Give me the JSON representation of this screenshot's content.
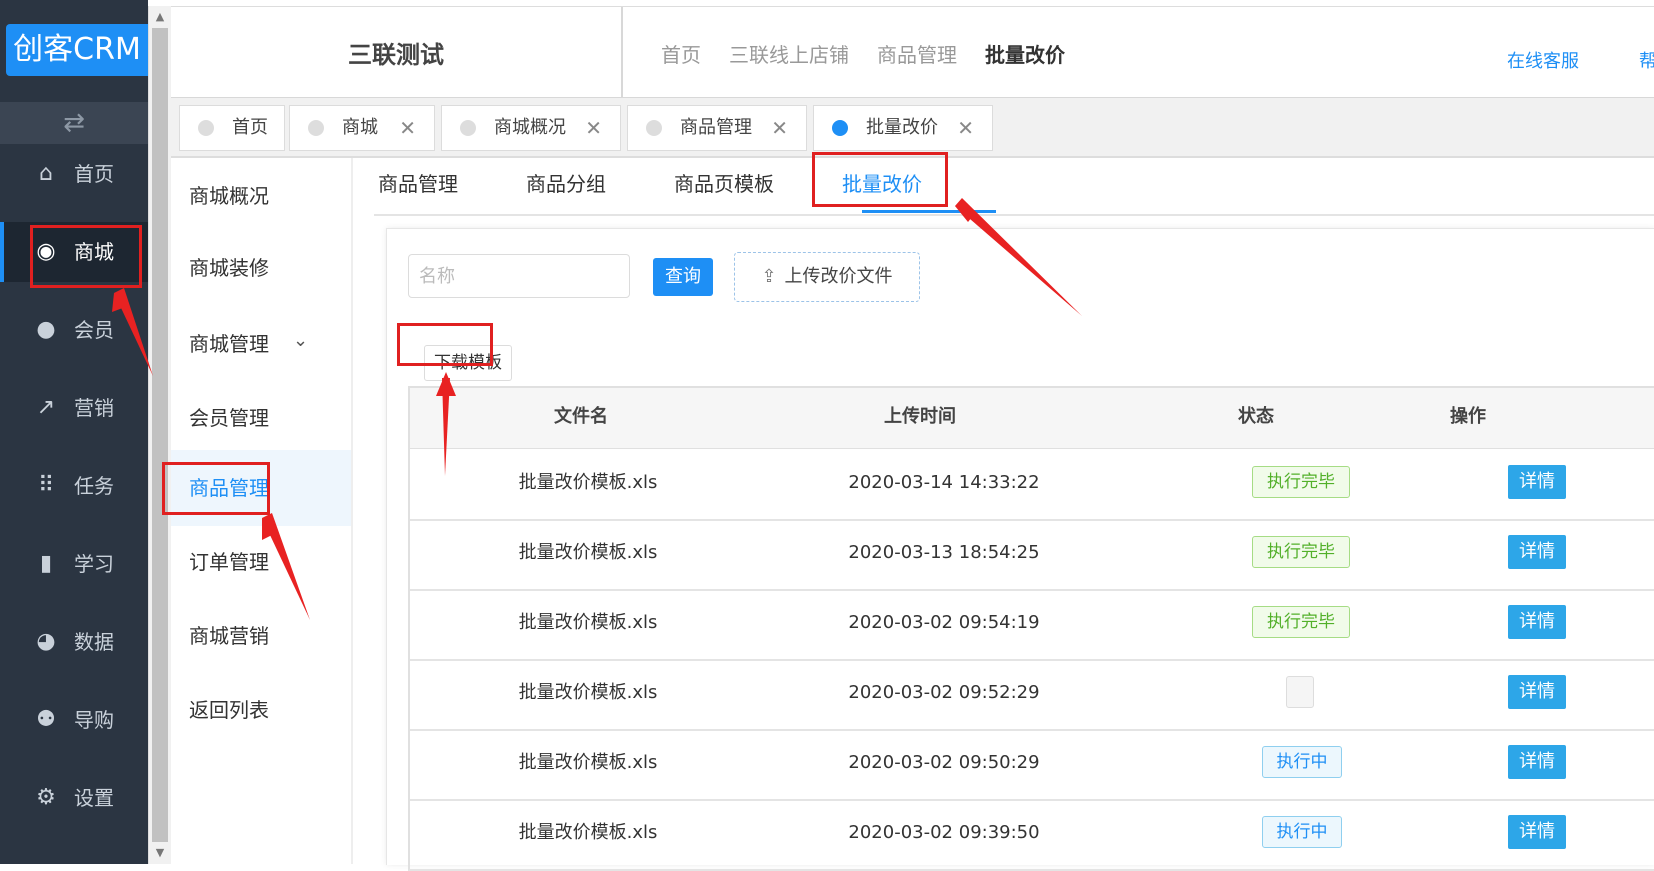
{
  "app": {
    "logo": "创客CRM",
    "toggle_icon": "swap-icon"
  },
  "leftnav": [
    {
      "label": "首页",
      "icon": "home-icon",
      "glyph": "⌂"
    },
    {
      "label": "商城",
      "icon": "store-icon",
      "glyph": "◉",
      "active": true
    },
    {
      "label": "会员",
      "icon": "user-icon",
      "glyph": "●"
    },
    {
      "label": "营销",
      "icon": "trend-icon",
      "glyph": "↗"
    },
    {
      "label": "任务",
      "icon": "grid-icon",
      "glyph": "⠿"
    },
    {
      "label": "学习",
      "icon": "book-icon",
      "glyph": "▮"
    },
    {
      "label": "数据",
      "icon": "pie-icon",
      "glyph": "◕"
    },
    {
      "label": "导购",
      "icon": "group-icon",
      "glyph": "⚉"
    },
    {
      "label": "设置",
      "icon": "gear-icon",
      "glyph": "⚙"
    }
  ],
  "header": {
    "shop_title": "三联测试",
    "breadcrumb": [
      "首页",
      "三联线上店铺",
      "商品管理",
      "批量改价"
    ],
    "service": "在线客服",
    "help": "帮"
  },
  "page_tabs": [
    {
      "label": "首页",
      "closable": false
    },
    {
      "label": "商城",
      "closable": true
    },
    {
      "label": "商城概况",
      "closable": true
    },
    {
      "label": "商品管理",
      "closable": true
    },
    {
      "label": "批量改价",
      "closable": true,
      "active": true
    }
  ],
  "subnav": [
    {
      "label": "商城概况"
    },
    {
      "label": "商城装修"
    },
    {
      "label": "商城管理",
      "expandable": true
    },
    {
      "label": "会员管理"
    },
    {
      "label": "商品管理",
      "active": true
    },
    {
      "label": "订单管理"
    },
    {
      "label": "商城营销"
    },
    {
      "label": "返回列表"
    }
  ],
  "content_tabs": [
    {
      "label": "商品管理"
    },
    {
      "label": "商品分组"
    },
    {
      "label": "商品页模板"
    },
    {
      "label": "批量改价",
      "active": true
    }
  ],
  "toolbar": {
    "name_placeholder": "名称",
    "query_label": "查询",
    "upload_label": "上传改价文件",
    "download_label": "下载模板"
  },
  "table": {
    "columns": [
      "文件名",
      "上传时间",
      "状态",
      "操作"
    ],
    "rows": [
      {
        "file": "批量改价模板.xls",
        "time": "2020-03-14 14:33:22",
        "status": "执行完毕",
        "status_type": "done",
        "action": "详情"
      },
      {
        "file": "批量改价模板.xls",
        "time": "2020-03-13 18:54:25",
        "status": "执行完毕",
        "status_type": "done",
        "action": "详情"
      },
      {
        "file": "批量改价模板.xls",
        "time": "2020-03-02 09:54:19",
        "status": "执行完毕",
        "status_type": "done",
        "action": "详情"
      },
      {
        "file": "批量改价模板.xls",
        "time": "2020-03-02 09:52:29",
        "status": "",
        "status_type": "empty",
        "action": "详情"
      },
      {
        "file": "批量改价模板.xls",
        "time": "2020-03-02 09:50:29",
        "status": "执行中",
        "status_type": "running",
        "action": "详情"
      },
      {
        "file": "批量改价模板.xls",
        "time": "2020-03-02 09:39:50",
        "status": "执行中",
        "status_type": "running",
        "action": "详情"
      }
    ]
  },
  "colors": {
    "accent": "#1e8ff5",
    "nav_bg": "#2b3542",
    "annotation": "#e02020"
  }
}
